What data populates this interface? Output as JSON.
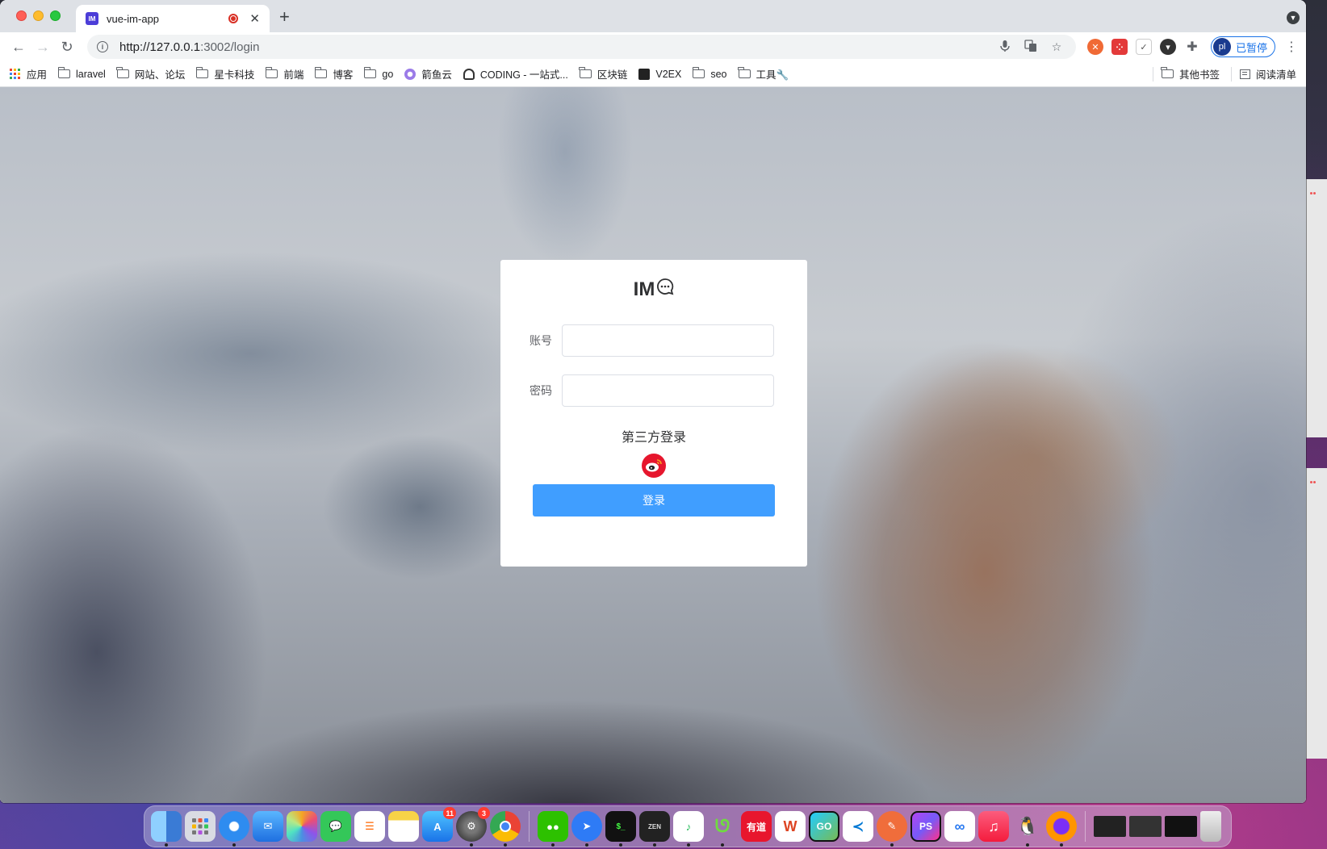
{
  "browser": {
    "tab": {
      "title": "vue-im-app",
      "favicon_text": "IM"
    },
    "url": {
      "host": "http://127.0.0.1",
      "path": ":3002/login"
    },
    "profile": {
      "initials": "pl",
      "status": "已暂停"
    }
  },
  "bookmarks": {
    "items": [
      {
        "label": "应用",
        "icon": "apps-icon"
      },
      {
        "label": "laravel",
        "icon": "folder-icon"
      },
      {
        "label": "网站、论坛",
        "icon": "folder-icon"
      },
      {
        "label": "星卡科技",
        "icon": "folder-icon"
      },
      {
        "label": "前端",
        "icon": "folder-icon"
      },
      {
        "label": "博客",
        "icon": "folder-icon"
      },
      {
        "label": "go",
        "icon": "folder-icon"
      },
      {
        "label": "箭鱼云",
        "icon": "site-icon"
      },
      {
        "label": "CODING - 一站式...",
        "icon": "coding-icon"
      },
      {
        "label": "区块链",
        "icon": "folder-icon"
      },
      {
        "label": "V2EX",
        "icon": "v2ex-icon"
      },
      {
        "label": "seo",
        "icon": "folder-icon"
      },
      {
        "label": "工具🔧",
        "icon": "folder-icon"
      }
    ],
    "other": "其他书签",
    "reading_list": "阅读清单"
  },
  "login": {
    "brand": "IM",
    "account_label": "账号",
    "account_value": "",
    "password_label": "密码",
    "password_value": "",
    "third_party_title": "第三方登录",
    "submit_label": "登录"
  },
  "dock": {
    "appstore_badge": "11",
    "settings_badge": "3",
    "youdao_label": "有道",
    "goland_label": "GO",
    "phpstorm_label": "PS"
  },
  "colors": {
    "primary": "#409eff",
    "weibo": "#e6162d",
    "tab_accent": "#4c3dd8"
  }
}
